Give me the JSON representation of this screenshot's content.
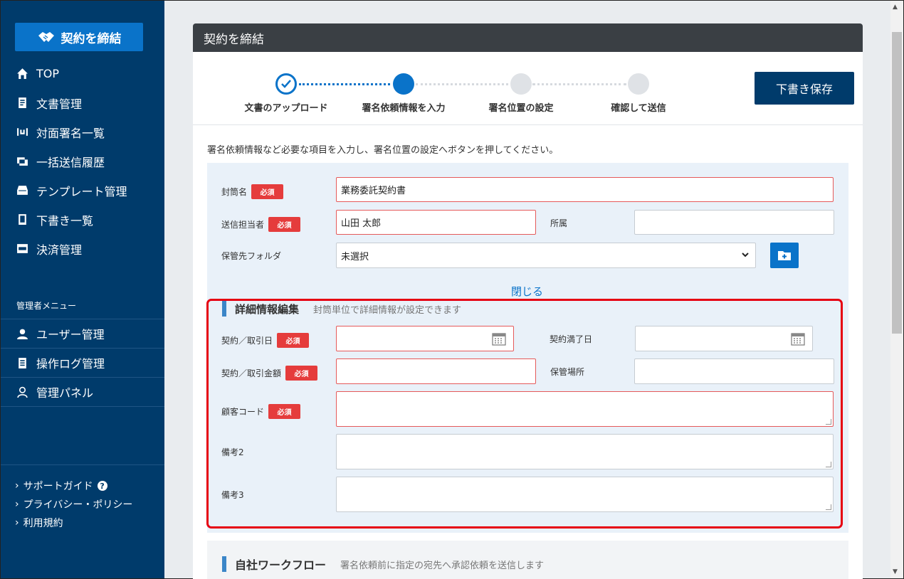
{
  "sidebar": {
    "brand_label": "契約を締結",
    "nav": [
      {
        "label": "TOP",
        "icon": "home-icon"
      },
      {
        "label": "文書管理",
        "icon": "document-icon"
      },
      {
        "label": "対面署名一覧",
        "icon": "face-sign-icon"
      },
      {
        "label": "一括送信履歴",
        "icon": "bulk-send-icon"
      },
      {
        "label": "テンプレート管理",
        "icon": "template-icon"
      },
      {
        "label": "下書き一覧",
        "icon": "draft-icon"
      },
      {
        "label": "決済管理",
        "icon": "pay-icon"
      }
    ],
    "admin_heading": "管理者メニュー",
    "admin_nav": [
      {
        "label": "ユーザー管理",
        "icon": "user-icon"
      },
      {
        "label": "操作ログ管理",
        "icon": "log-icon"
      },
      {
        "label": "管理パネル",
        "icon": "admin-panel-icon"
      }
    ],
    "footer_links": [
      {
        "label": "サポートガイド"
      },
      {
        "label": "プライバシー・ポリシー"
      },
      {
        "label": "利用規約"
      }
    ]
  },
  "card": {
    "title": "契約を締結",
    "draft_button": "下書き保存",
    "steps": [
      {
        "label": "文書のアップロード",
        "state": "done"
      },
      {
        "label": "署名依頼情報を入力",
        "state": "current"
      },
      {
        "label": "署名位置の設定",
        "state": "pending"
      },
      {
        "label": "確認して送信",
        "state": "pending"
      }
    ],
    "instruction": "署名依頼情報など必要な項目を入力し、署名位置の設定へボタンを押してください。"
  },
  "form": {
    "required_badge": "必須",
    "envelope_name_label": "封筒名",
    "envelope_name_value": "業務委託契約書",
    "sender_label": "送信担当者",
    "sender_value": "山田 太郎",
    "affiliation_label": "所属",
    "affiliation_value": "",
    "folder_label": "保管先フォルダ",
    "folder_value": "未選択",
    "close_link": "閉じる"
  },
  "details": {
    "title": "詳細情報編集",
    "subtitle": "封筒単位で詳細情報が設定できます",
    "contract_date_label": "契約／取引日",
    "expiry_date_label": "契約満了日",
    "amount_label": "契約／取引金額",
    "storage_place_label": "保管場所",
    "customer_code_label": "顧客コード",
    "note2_label": "備考2",
    "note3_label": "備考3"
  },
  "workflow": {
    "title": "自社ワークフロー",
    "subtitle": "署名依頼前に指定の宛先へ承認依頼を送信します"
  },
  "colors": {
    "sidebar_bg": "#003b6b",
    "accent": "#0a73c9",
    "required": "#e53c3c",
    "highlight_border": "#e60012"
  }
}
